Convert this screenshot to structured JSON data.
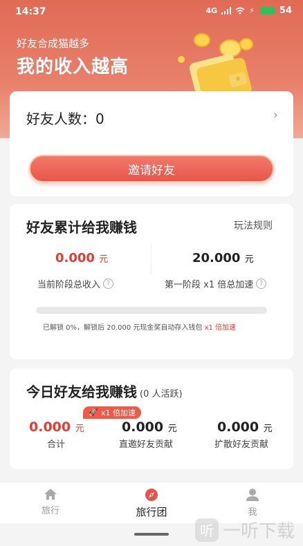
{
  "status_bar": {
    "time": "14:37",
    "network": "4G",
    "battery": "54"
  },
  "hero": {
    "subtitle": "好友合成猫越多",
    "title": "我的收入越高"
  },
  "friend_card": {
    "count_label": "好友人数：",
    "count_value": "0",
    "invite_button": "邀请好友"
  },
  "earnings_card": {
    "title": "好友累计给我赚钱",
    "rules_link": "玩法规则",
    "stage_income": {
      "value": "0.000",
      "unit": "元",
      "label": "当前阶段总收入"
    },
    "stage_target": {
      "value": "20.000",
      "unit": "元",
      "label": "第一阶段 x1 倍总加速"
    },
    "progress_percent": 0,
    "unlock_note_prefix": "已解锁 0%，解锁后 20.000 元现金奖自动存入钱包 ",
    "unlock_note_highlight": "x1 倍加速"
  },
  "today_card": {
    "title": "今日好友给我赚钱",
    "active_note": "(0 人活跃)",
    "boost_badge": "x1 倍加速",
    "total": {
      "value": "0.000",
      "unit": "元",
      "label": "合计"
    },
    "direct": {
      "value": "0.000",
      "unit": "元",
      "label": "直邀好友贡献"
    },
    "spread": {
      "value": "0.000",
      "unit": "元",
      "label": "扩散好友贡献"
    }
  },
  "tabbar": {
    "tabs": [
      {
        "label": "旅行",
        "icon": "home-icon",
        "active": false
      },
      {
        "label": "旅行团",
        "icon": "compass-icon",
        "active": true
      },
      {
        "label": "我",
        "icon": "person-icon",
        "active": false
      }
    ]
  },
  "watermark": {
    "text": "一听下载",
    "logo_glyph": "听"
  },
  "colors": {
    "accent": "#e8544a",
    "hero_top": "#e06b55",
    "highlight_red": "#e63b2e"
  }
}
